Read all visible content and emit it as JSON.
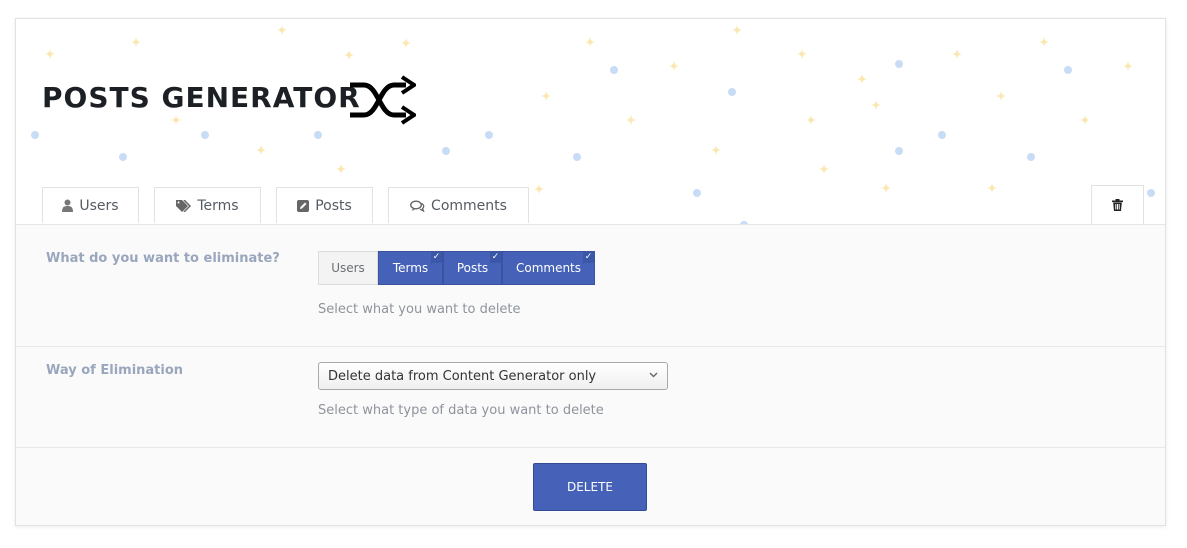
{
  "header": {
    "title": "POSTS GENERATOR",
    "icon": "shuffle-icon"
  },
  "tabs": [
    {
      "label": "Users",
      "icon": "user-icon"
    },
    {
      "label": "Terms",
      "icon": "tags-icon"
    },
    {
      "label": "Posts",
      "icon": "edit-icon"
    },
    {
      "label": "Comments",
      "icon": "comments-icon"
    },
    {
      "label": "",
      "icon": "trash-icon"
    }
  ],
  "eliminate": {
    "label": "What do you want to eliminate?",
    "options": [
      {
        "label": "Users",
        "selected": false
      },
      {
        "label": "Terms",
        "selected": true
      },
      {
        "label": "Posts",
        "selected": true
      },
      {
        "label": "Comments",
        "selected": true
      }
    ],
    "check_mark": "✓",
    "hint": "Select what you want to delete"
  },
  "way": {
    "label": "Way of Elimination",
    "selected": "Delete data from Content Generator only",
    "hint": "Select what type of data you want to delete"
  },
  "actions": {
    "delete_label": "DELETE"
  },
  "colors": {
    "accent": "#4562b8",
    "title": "#1c1f24",
    "label": "#9aa6bd",
    "decor_star": "#fbe7b2",
    "decor_dot": "#c9dcf5"
  }
}
